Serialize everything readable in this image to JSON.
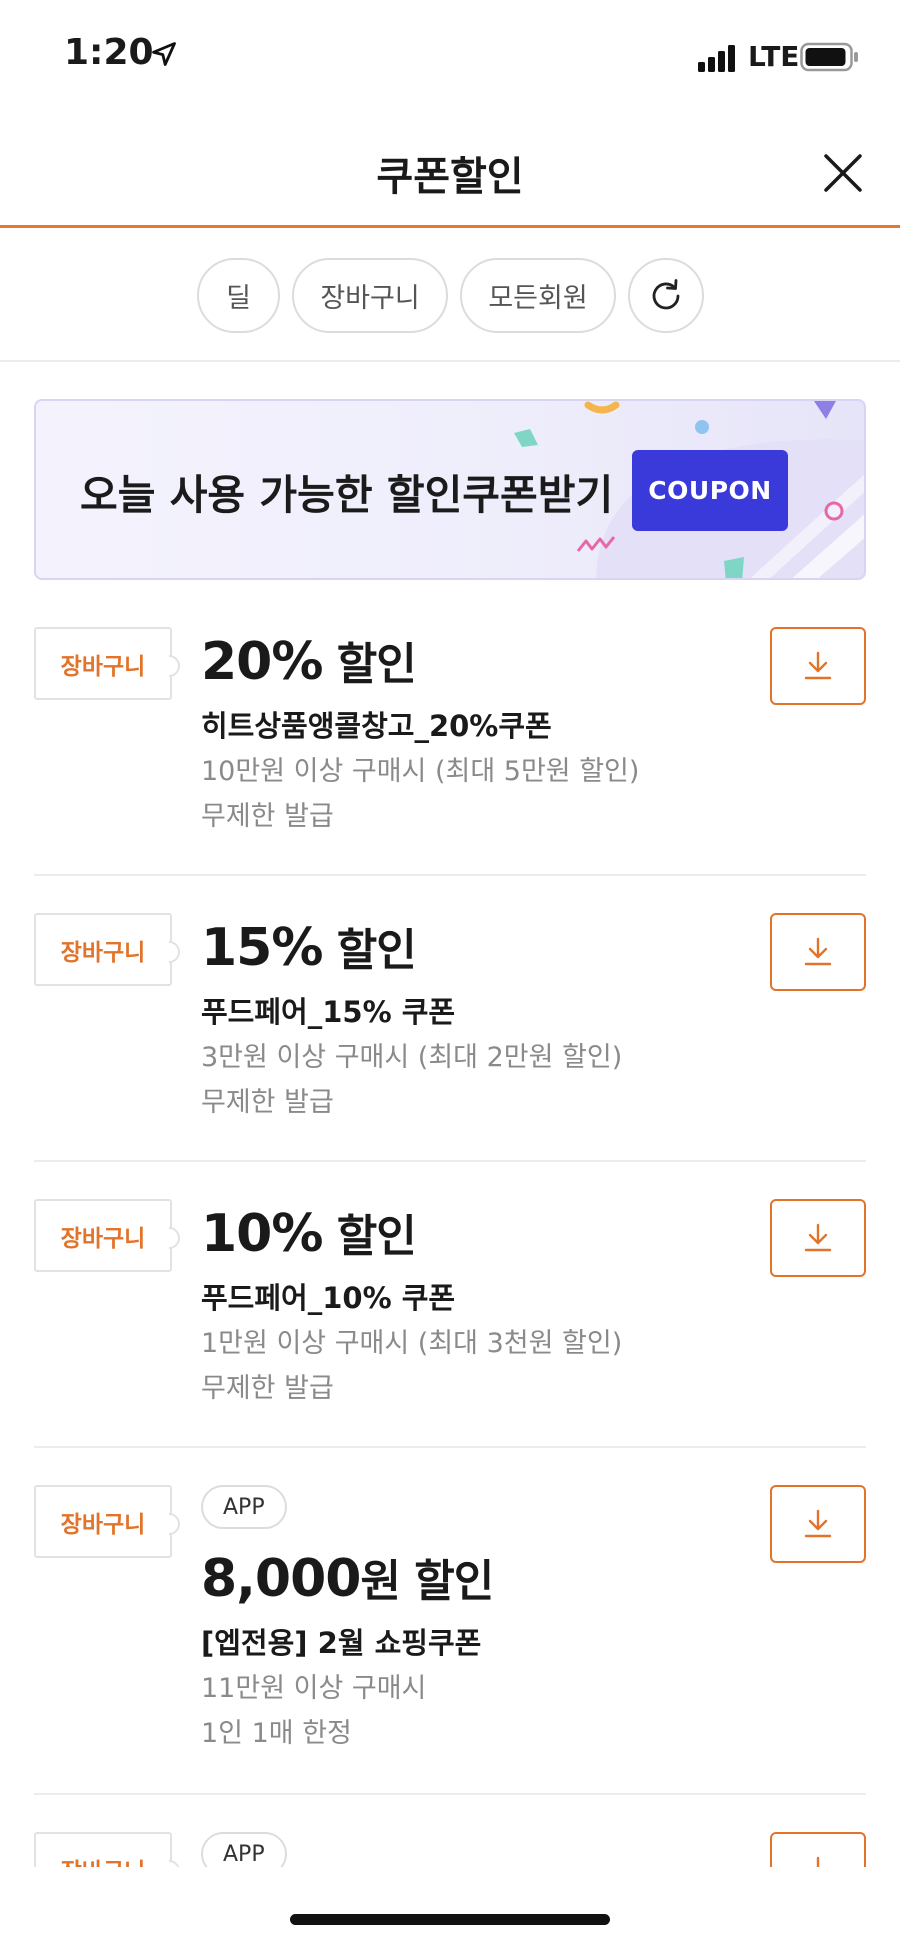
{
  "status_bar": {
    "time": "1:20",
    "network": "LTE",
    "icons": [
      "location-arrow-icon",
      "signal-icon",
      "battery-icon"
    ]
  },
  "header": {
    "title": "쿠폰할인",
    "close_icon": "close-icon"
  },
  "filters": {
    "chips": [
      "딜",
      "장바구니",
      "모든회원"
    ],
    "refresh_icon": "refresh-icon"
  },
  "banner": {
    "text": "오늘 사용 가능한 할인쿠폰받기",
    "tag": "COUPON"
  },
  "coupons": [
    {
      "badge": "장바구니",
      "app": "",
      "amount": "20%",
      "amount_unit": " 할인",
      "name": "히트상품앵콜창고_20%쿠폰",
      "condition": "10만원 이상 구매시 (최대 5만원 할인)",
      "limit": "무제한 발급",
      "download_icon": "download-icon"
    },
    {
      "badge": "장바구니",
      "app": "",
      "amount": "15%",
      "amount_unit": " 할인",
      "name": "푸드페어_15% 쿠폰",
      "condition": "3만원 이상 구매시 (최대 2만원 할인)",
      "limit": "무제한 발급",
      "download_icon": "download-icon"
    },
    {
      "badge": "장바구니",
      "app": "",
      "amount": "10%",
      "amount_unit": " 할인",
      "name": "푸드페어_10% 쿠폰",
      "condition": "1만원 이상 구매시 (최대 3천원 할인)",
      "limit": "무제한 발급",
      "download_icon": "download-icon"
    },
    {
      "badge": "장바구니",
      "app": "APP",
      "amount": "8,000",
      "amount_unit": "원 할인",
      "name": "[엡전용] 2월 쇼핑쿠폰",
      "condition": "11만원 이상 구매시",
      "limit": "1인 1매 한정",
      "download_icon": "download-icon"
    },
    {
      "badge": "장바구니",
      "app": "APP",
      "amount": "",
      "amount_unit": "",
      "name": "",
      "condition": "",
      "limit": "",
      "download_icon": "download-icon"
    }
  ],
  "colors": {
    "accent": "#e8762c",
    "coupon_tag": "#3a3adb",
    "banner_bg": "#eeedfb",
    "muted_text": "#8a8a8a"
  }
}
